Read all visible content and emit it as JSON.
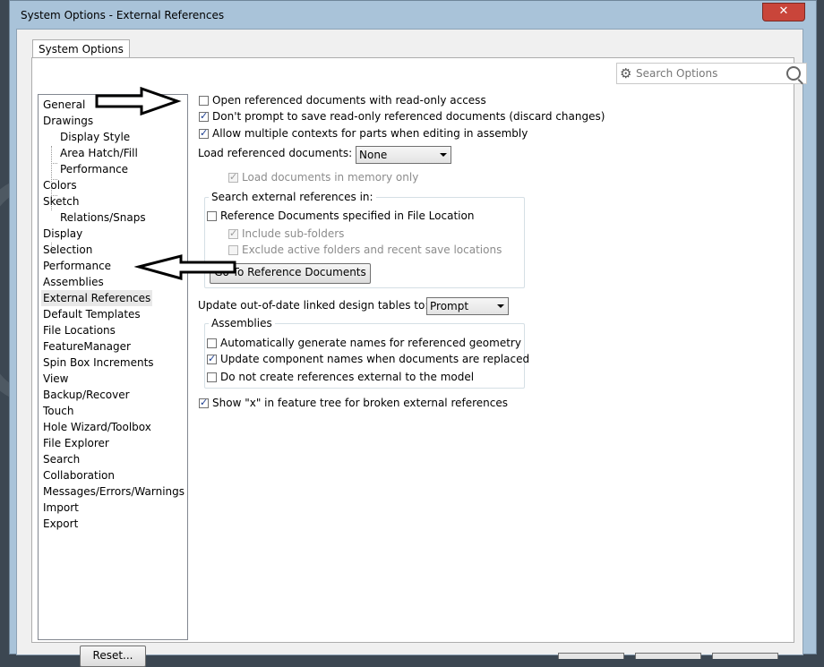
{
  "window": {
    "title": "System Options - External References",
    "close_label": "✕"
  },
  "tab_label": "System Options",
  "search": {
    "placeholder": "Search Options",
    "icon_gear": "gear-icon",
    "icon_search": "search-icon"
  },
  "tree": {
    "items": [
      {
        "label": "General",
        "level": 0
      },
      {
        "label": "Drawings",
        "level": 0
      },
      {
        "label": "Display Style",
        "level": 1
      },
      {
        "label": "Area Hatch/Fill",
        "level": 1
      },
      {
        "label": "Performance",
        "level": 1
      },
      {
        "label": "Colors",
        "level": 0
      },
      {
        "label": "Sketch",
        "level": 0
      },
      {
        "label": "Relations/Snaps",
        "level": 1
      },
      {
        "label": "Display",
        "level": 0
      },
      {
        "label": "Selection",
        "level": 0
      },
      {
        "label": "Performance",
        "level": 0
      },
      {
        "label": "Assemblies",
        "level": 0
      },
      {
        "label": "External References",
        "level": 0,
        "selected": true
      },
      {
        "label": "Default Templates",
        "level": 0
      },
      {
        "label": "File Locations",
        "level": 0
      },
      {
        "label": "FeatureManager",
        "level": 0
      },
      {
        "label": "Spin Box Increments",
        "level": 0
      },
      {
        "label": "View",
        "level": 0
      },
      {
        "label": "Backup/Recover",
        "level": 0
      },
      {
        "label": "Touch",
        "level": 0
      },
      {
        "label": "Hole Wizard/Toolbox",
        "level": 0
      },
      {
        "label": "File Explorer",
        "level": 0
      },
      {
        "label": "Search",
        "level": 0
      },
      {
        "label": "Collaboration",
        "level": 0
      },
      {
        "label": "Messages/Errors/Warnings",
        "level": 0
      },
      {
        "label": "Import",
        "level": 0
      },
      {
        "label": "Export",
        "level": 0
      }
    ]
  },
  "reset_label": "Reset...",
  "options": {
    "open_readonly": {
      "label": "Open referenced documents with read-only access",
      "checked": false
    },
    "dont_prompt": {
      "label": "Don't prompt to save read-only referenced documents (discard changes)",
      "checked": true
    },
    "allow_multiple": {
      "label": "Allow multiple contexts for parts when editing in assembly",
      "checked": true
    },
    "load_refs_label": "Load referenced documents:",
    "load_refs_value": "None",
    "load_memory": {
      "label": "Load documents in memory only",
      "checked": true,
      "disabled": true
    },
    "search_group_title": "Search external references in:",
    "ref_docs_file_location": {
      "label": "Reference Documents specified in File Location",
      "checked": false
    },
    "include_subfolders": {
      "label": "Include sub-folders",
      "checked": true,
      "disabled": true
    },
    "exclude_active": {
      "label": "Exclude active folders and recent save locations",
      "checked": false,
      "disabled": true
    },
    "go_to_ref_docs": "Go To Reference Documents",
    "update_tables_label": "Update out-of-date linked design tables to:",
    "update_tables_value": "Prompt",
    "assemblies_group_title": "Assemblies",
    "auto_names": {
      "label": "Automatically generate names for referenced geometry",
      "checked": false
    },
    "update_component_names": {
      "label": "Update component names when documents are replaced",
      "checked": true
    },
    "no_external_refs": {
      "label": "Do not create references external to the model",
      "checked": false
    },
    "show_x": {
      "label": "Show \"x\" in feature tree for broken external references",
      "checked": true
    }
  }
}
